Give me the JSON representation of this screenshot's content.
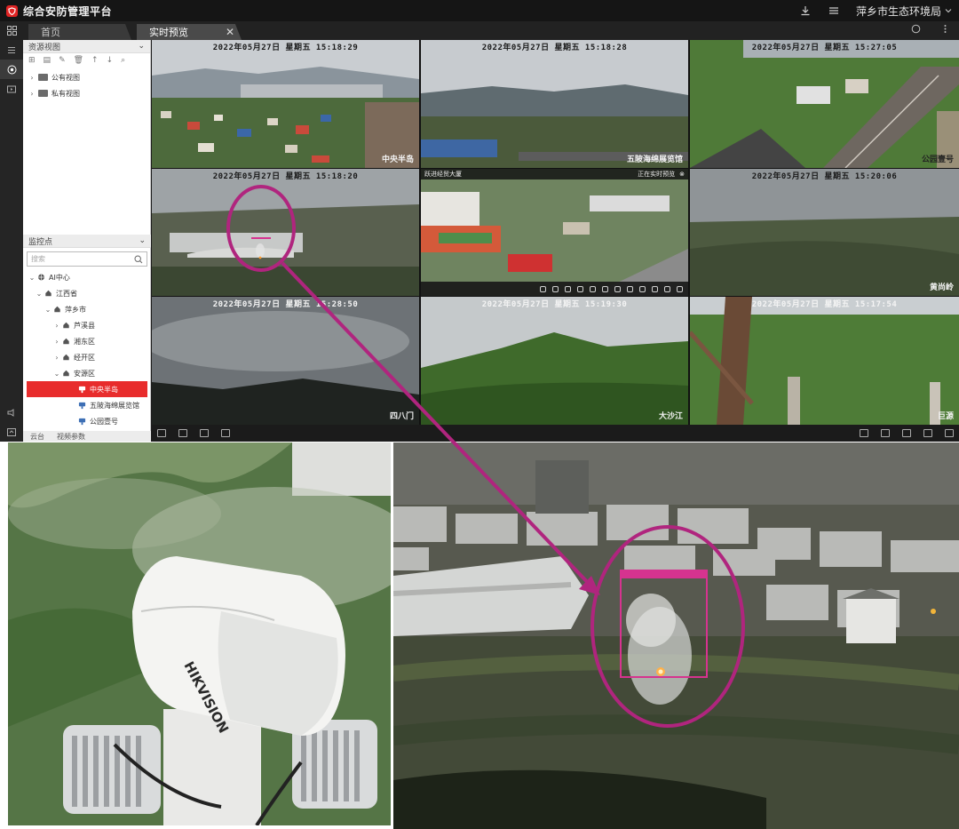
{
  "app": {
    "title": "综合安防管理平台",
    "org_name": "萍乡市生态环境局"
  },
  "tabs": [
    {
      "label": "首页",
      "active": false
    },
    {
      "label": "实时预览",
      "active": true
    }
  ],
  "resource_panel": {
    "header": "资源视图",
    "items": [
      {
        "label": "公有视图"
      },
      {
        "label": "私有视图"
      }
    ]
  },
  "monitor_panel": {
    "header": "监控点",
    "search_placeholder": "搜索",
    "tree": [
      {
        "label": "AI中心"
      },
      {
        "label": "江西省"
      },
      {
        "label": "萍乡市"
      },
      {
        "label": "芦溪县"
      },
      {
        "label": "湘东区"
      },
      {
        "label": "经开区"
      },
      {
        "label": "安源区"
      },
      {
        "label": "中央半岛",
        "selected": true
      },
      {
        "label": "五陂海绵展览馆"
      },
      {
        "label": "公园壹号"
      }
    ],
    "footer_tabs": [
      "云台",
      "视频参数"
    ]
  },
  "video_tiles": [
    {
      "osd": "2022年05月27日  星期五  15:18:29",
      "label": "中央半岛"
    },
    {
      "osd": "2022年05月27日  星期五  15:18:28",
      "label": "五陂海绵展览馆"
    },
    {
      "osd": "2022年05月27日  星期五  15:27:05",
      "label": "公园壹号"
    },
    {
      "osd": "2022年05月27日  星期五  15:18:20",
      "label": ""
    },
    {
      "osd": "",
      "label": "",
      "head_title": "跃进经贸大厦",
      "head_status": "正在实时预览"
    },
    {
      "osd": "2022年05月27日  星期五  15:20:06",
      "label": "黄尚岭"
    },
    {
      "osd": "2022年05月27日  星期五  15:28:50",
      "label": "四八门"
    },
    {
      "osd": "2022年05月27日  星期五  15:19:30",
      "label": "大沙江"
    },
    {
      "osd": "2022年05月27日  星期五  15:17:54",
      "label": "巨源"
    }
  ],
  "camera_brand": "HIKVISION",
  "colors": {
    "accent_red": "#e82c2c",
    "annotation_magenta": "#b0257e",
    "detection_box": "#d6338f"
  },
  "icons": [
    "download-icon",
    "menu-icon",
    "grid-icon",
    "layout-icon",
    "fullscreen-icon",
    "settings-icon",
    "search-icon",
    "camera-icon",
    "home-icon",
    "folder-icon"
  ]
}
